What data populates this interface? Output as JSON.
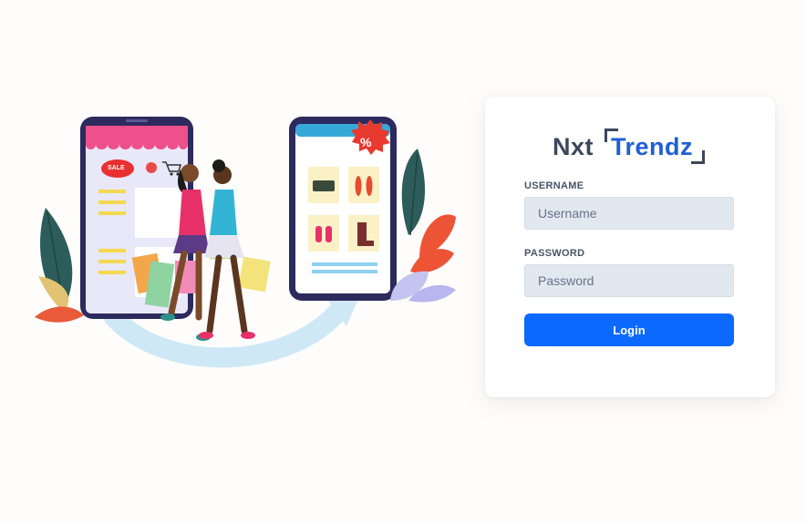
{
  "brand": {
    "prefix": "Nxt",
    "suffix": "Trendz"
  },
  "illustration": {
    "sale_badge": "SALE",
    "discount_badge": "%"
  },
  "form": {
    "username": {
      "label": "USERNAME",
      "placeholder": "Username",
      "value": ""
    },
    "password": {
      "label": "PASSWORD",
      "placeholder": "Password",
      "value": ""
    },
    "submit_label": "Login"
  },
  "colors": {
    "primary_button": "#0b69ff",
    "brand_blue": "#1e5fd6",
    "brand_dark": "#3c475b",
    "input_bg": "#e2e8f0"
  },
  "icons": [
    "cart-icon",
    "handbag-icon",
    "shoe-icon",
    "boot-icon",
    "sneaker-icon",
    "arrow-icon",
    "leaf-icon",
    "flower-icon"
  ]
}
